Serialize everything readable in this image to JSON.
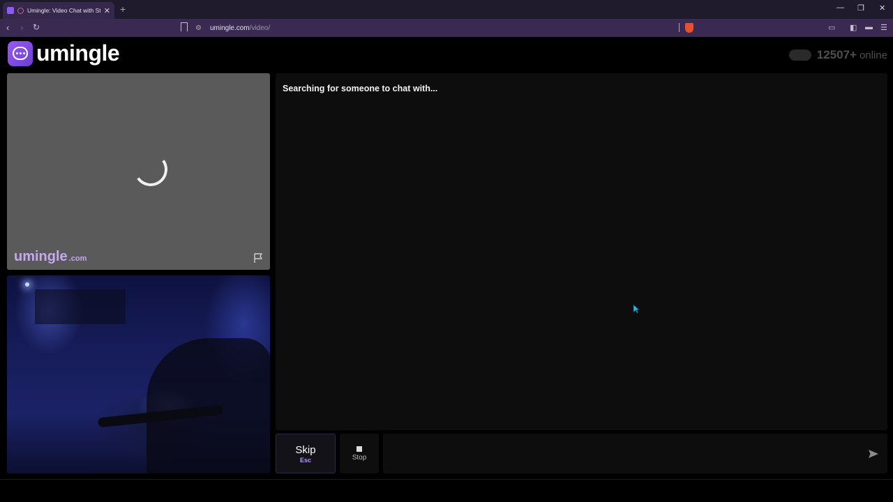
{
  "browser": {
    "tab_title": "Umingle: Video Chat with Strangers",
    "tab_close": "✕",
    "new_tab": "+",
    "url_host": "umingle.com",
    "url_path": "/video/",
    "window_controls": {
      "minimize": "—",
      "maximize": "❐",
      "close": "✕"
    }
  },
  "header": {
    "logo_text": "umingle",
    "online_count": "12507+",
    "online_suffix": "online"
  },
  "stranger_video": {
    "watermark_main": "umingle",
    "watermark_suffix": ".com",
    "state": "loading"
  },
  "chat": {
    "status_message": "Searching for someone to chat with...",
    "input_value": "",
    "input_placeholder": ""
  },
  "controls": {
    "skip_label": "Skip",
    "skip_key": "Esc",
    "stop_label": "Stop"
  },
  "colors": {
    "accent": "#8a5cf6",
    "watermark": "#c4a8f0",
    "panel_bg": "#0d0d0d",
    "video_placeholder_bg": "#5a5a5a"
  },
  "icons": [
    "chat-bubble-icon",
    "flag-icon",
    "stop-icon",
    "send-icon",
    "back-icon",
    "forward-icon",
    "reload-icon",
    "bookmark-icon",
    "brave-shield-icon"
  ]
}
